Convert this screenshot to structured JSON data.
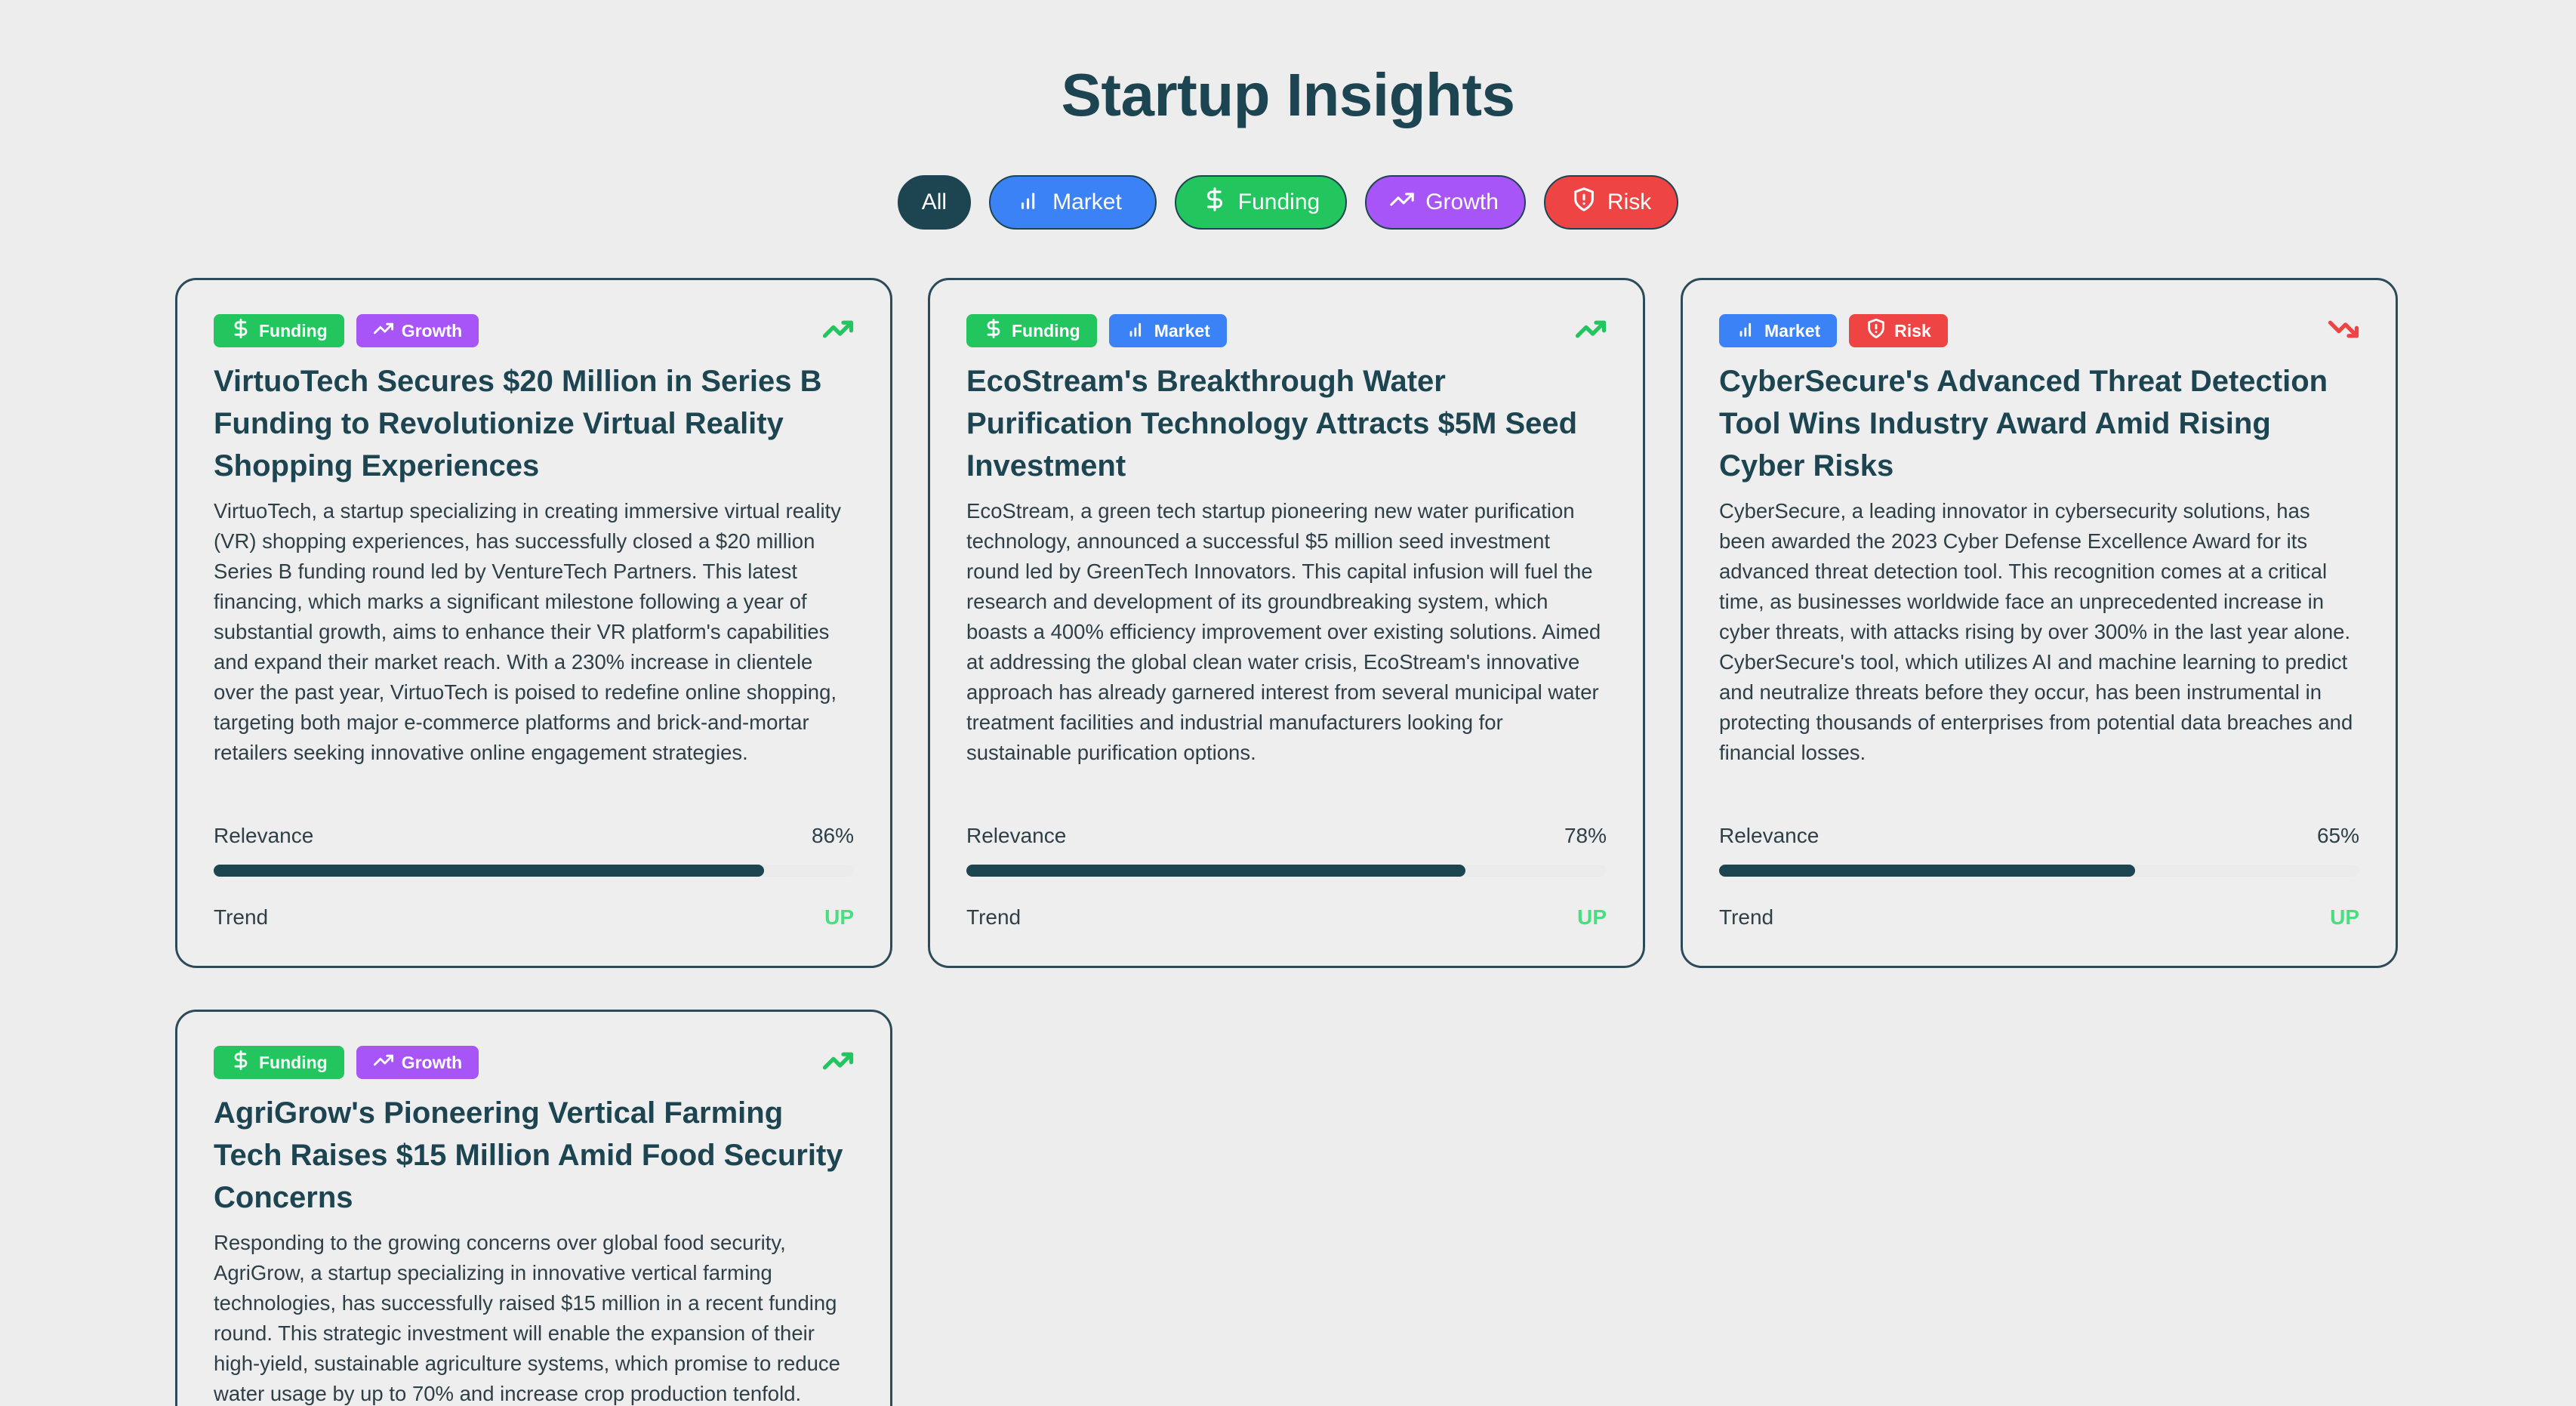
{
  "page": {
    "title": "Startup Insights"
  },
  "filters": [
    {
      "label": "All",
      "icon": ""
    },
    {
      "label": "Market",
      "icon": "bar-chart-icon"
    },
    {
      "label": "Funding",
      "icon": "dollar-icon"
    },
    {
      "label": "Growth",
      "icon": "trending-up-icon"
    },
    {
      "label": "Risk",
      "icon": "shield-icon"
    }
  ],
  "colors": {
    "funding": "#22c55e",
    "growth": "#a855f7",
    "market": "#3b82f6",
    "risk": "#ef4444",
    "primary": "#1d4451",
    "trend_up": "#4ade80"
  },
  "cards": [
    {
      "tags": [
        "Funding",
        "Growth"
      ],
      "trend_icon": "trending-up-icon",
      "title": "VirtuoTech Secures $20 Million in Series B Funding to Revolutionize Virtual Reality Shopping Experiences",
      "body": "VirtuoTech, a startup specializing in creating immersive virtual reality (VR) shopping experiences, has successfully closed a $20 million Series B funding round led by VentureTech Partners. This latest financing, which marks a significant milestone following a year of substantial growth, aims to enhance their VR platform's capabilities and expand their market reach. With a 230% increase in clientele over the past year, VirtuoTech is poised to redefine online shopping, targeting both major e-commerce platforms and brick-and-mortar retailers seeking innovative online engagement strategies.",
      "relevance_label": "Relevance",
      "relevance_text": "86%",
      "relevance": 0.86,
      "trend_label": "Trend",
      "trend": "UP"
    },
    {
      "tags": [
        "Funding",
        "Market"
      ],
      "trend_icon": "trending-up-icon",
      "title": "EcoStream's Breakthrough Water Purification Technology Attracts $5M Seed Investment",
      "body": "EcoStream, a green tech startup pioneering new water purification technology, announced a successful $5 million seed investment round led by GreenTech Innovators. This capital infusion will fuel the research and development of its groundbreaking system, which boasts a 400% efficiency improvement over existing solutions. Aimed at addressing the global clean water crisis, EcoStream's innovative approach has already garnered interest from several municipal water treatment facilities and industrial manufacturers looking for sustainable purification options.",
      "relevance_label": "Relevance",
      "relevance_text": "78%",
      "relevance": 0.78,
      "trend_label": "Trend",
      "trend": "UP"
    },
    {
      "tags": [
        "Market",
        "Risk"
      ],
      "trend_icon": "trending-down-icon",
      "title": "CyberSecure's Advanced Threat Detection Tool Wins Industry Award Amid Rising Cyber Risks",
      "body": "CyberSecure, a leading innovator in cybersecurity solutions, has been awarded the 2023 Cyber Defense Excellence Award for its advanced threat detection tool. This recognition comes at a critical time, as businesses worldwide face an unprecedented increase in cyber threats, with attacks rising by over 300% in the last year alone. CyberSecure's tool, which utilizes AI and machine learning to predict and neutralize threats before they occur, has been instrumental in protecting thousands of enterprises from potential data breaches and financial losses.",
      "relevance_label": "Relevance",
      "relevance_text": "65%",
      "relevance": 0.65,
      "trend_label": "Trend",
      "trend": "UP"
    },
    {
      "tags": [
        "Funding",
        "Growth"
      ],
      "trend_icon": "trending-up-icon",
      "title": "AgriGrow's Pioneering Vertical Farming Tech Raises $15 Million Amid Food Security Concerns",
      "body": "Responding to the growing concerns over global food security, AgriGrow, a startup specializing in innovative vertical farming technologies, has successfully raised $15 million in a recent funding round. This strategic investment will enable the expansion of their high-yield, sustainable agriculture systems, which promise to reduce water usage by up to 70% and increase crop production tenfold.",
      "relevance_label": "",
      "relevance_text": "",
      "relevance": null,
      "trend_label": "",
      "trend": ""
    }
  ]
}
